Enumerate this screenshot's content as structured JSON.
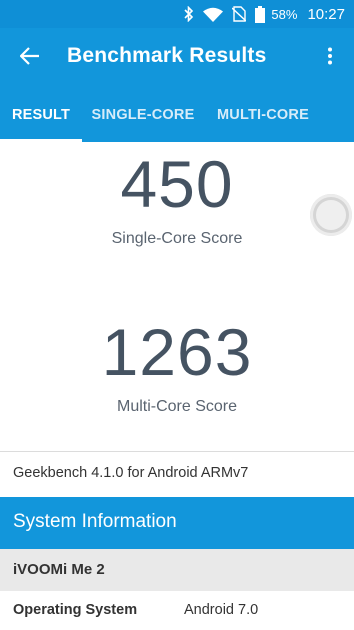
{
  "status_bar": {
    "battery_percent": "58%",
    "time": "10:27",
    "icons": [
      "bluetooth-icon",
      "wifi-icon",
      "no-sim-icon",
      "battery-icon"
    ]
  },
  "app_bar": {
    "title": "Benchmark Results",
    "back_icon": "arrow-left-icon",
    "menu_icon": "more-vert-icon"
  },
  "tabs": [
    {
      "label": "RESULT",
      "active": true
    },
    {
      "label": "SINGLE-CORE",
      "active": false
    },
    {
      "label": "MULTI-CORE",
      "active": false
    }
  ],
  "scores": {
    "single_value": "450",
    "single_label": "Single-Core Score",
    "multi_value": "1263",
    "multi_label": "Multi-Core Score"
  },
  "version_text": "Geekbench 4.1.0 for Android ARMv7",
  "system_information": {
    "header": "System Information",
    "device": "iVOOMi Me 2",
    "rows": [
      {
        "key": "Operating System",
        "value": "Android 7.0"
      }
    ]
  },
  "colors": {
    "primary": "#1296db",
    "status_bar": "#0f8fd6",
    "score_text": "#455362"
  }
}
